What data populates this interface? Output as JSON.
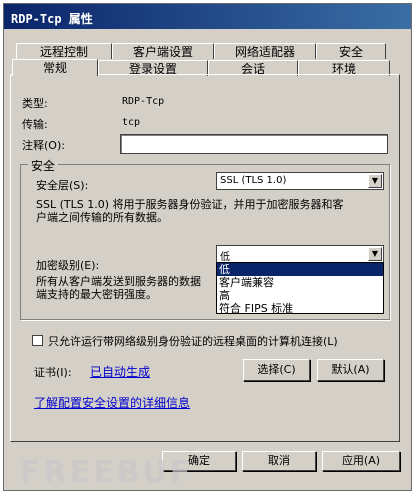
{
  "window": {
    "title": "RDP-Tcp 属性"
  },
  "tabs": {
    "row1": [
      "远程控制",
      "客户端设置",
      "网络适配器",
      "安全"
    ],
    "row2": [
      "常规",
      "登录设置",
      "会话",
      "环境"
    ]
  },
  "general": {
    "type_label": "类型:",
    "type_value": "RDP-Tcp",
    "transport_label": "传输:",
    "transport_value": "tcp",
    "comment_label": "注释(O):",
    "comment_value": ""
  },
  "security": {
    "group_title": "安全",
    "layer_label": "安全层(S):",
    "layer_value": "SSL (TLS 1.0)",
    "layer_desc_line1": "SSL (TLS 1.0) 将用于服务器身份验证，并用于加密服务器和客",
    "layer_desc_line2": "户端之间传输的所有数据。",
    "encryption_label": "加密级别(E):",
    "encryption_value": "低",
    "encryption_desc_line1": "所有从客户端发送到服务器的数据",
    "encryption_desc_line2": "端支持的最大密钥强度。",
    "encryption_options": [
      "低",
      "客户端兼容",
      "高",
      "符合 FIPS 标准"
    ],
    "selected_option_index": 0
  },
  "nla": {
    "checkbox_label": "只允许运行带网络级别身份验证的远程桌面的计算机连接(L)",
    "checked": false
  },
  "certificate": {
    "label": "证书(I):",
    "value": "已自动生成",
    "select_button": "选择(C)",
    "default_button": "默认(A)"
  },
  "help_link": "了解配置安全设置的详细信息",
  "footer": {
    "ok": "确定",
    "cancel": "取消",
    "apply": "应用(A)"
  },
  "watermark": "FREEBUF"
}
